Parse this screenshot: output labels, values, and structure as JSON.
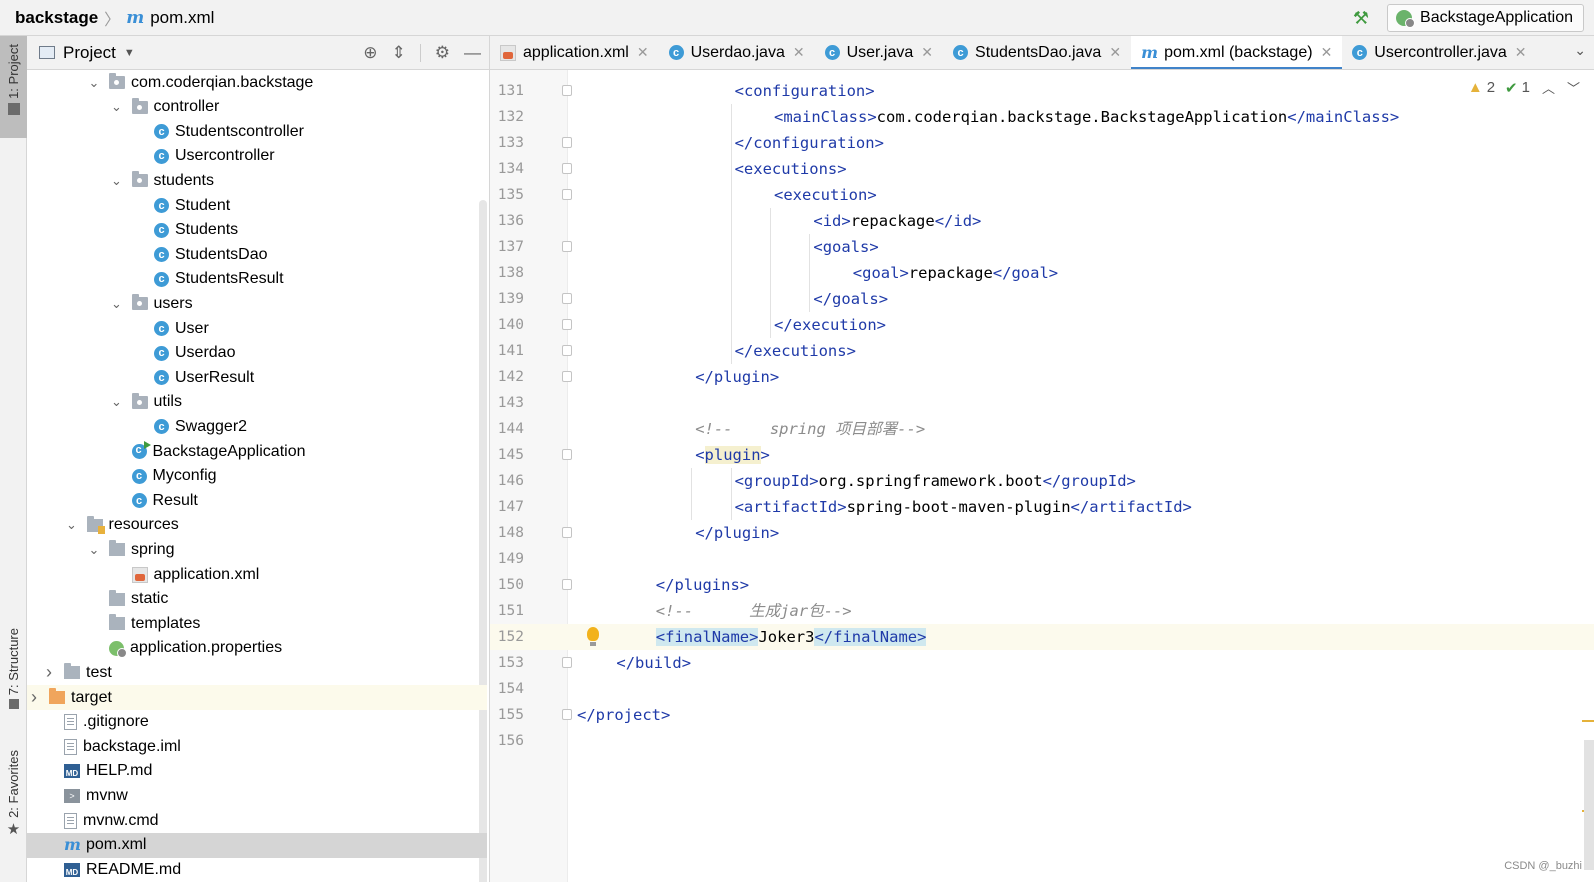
{
  "breadcrumb": {
    "root": "backstage",
    "file": "pom.xml"
  },
  "run_config": {
    "label": "BackstageApplication"
  },
  "left_strip": {
    "project_tab": "1: Project",
    "structure_tab": "7: Structure",
    "favorites_tab": "2: Favorites"
  },
  "project_panel": {
    "title": "Project"
  },
  "tree": [
    {
      "label": "com.coderqian.backstage",
      "icon": "pkg",
      "depth": 4,
      "arrow": "open"
    },
    {
      "label": "controller",
      "icon": "pkg",
      "depth": 5,
      "arrow": "open"
    },
    {
      "label": "Studentscontroller",
      "icon": "cls",
      "depth": 6,
      "arrow": "none"
    },
    {
      "label": "Usercontroller",
      "icon": "cls",
      "depth": 6,
      "arrow": "none"
    },
    {
      "label": "students",
      "icon": "pkg",
      "depth": 5,
      "arrow": "open"
    },
    {
      "label": "Student",
      "icon": "cls",
      "depth": 6,
      "arrow": "none"
    },
    {
      "label": "Students",
      "icon": "cls",
      "depth": 6,
      "arrow": "none"
    },
    {
      "label": "StudentsDao",
      "icon": "cls",
      "depth": 6,
      "arrow": "none"
    },
    {
      "label": "StudentsResult",
      "icon": "cls",
      "depth": 6,
      "arrow": "none"
    },
    {
      "label": "users",
      "icon": "pkg",
      "depth": 5,
      "arrow": "open"
    },
    {
      "label": "User",
      "icon": "cls",
      "depth": 6,
      "arrow": "none"
    },
    {
      "label": "Userdao",
      "icon": "cls",
      "depth": 6,
      "arrow": "none"
    },
    {
      "label": "UserResult",
      "icon": "cls",
      "depth": 6,
      "arrow": "none"
    },
    {
      "label": "utils",
      "icon": "pkg",
      "depth": 5,
      "arrow": "open"
    },
    {
      "label": "Swagger2",
      "icon": "cls",
      "depth": 6,
      "arrow": "none"
    },
    {
      "label": "BackstageApplication",
      "icon": "app",
      "depth": 5,
      "arrow": "none"
    },
    {
      "label": "Myconfig",
      "icon": "cls",
      "depth": 5,
      "arrow": "none"
    },
    {
      "label": "Result",
      "icon": "cls",
      "depth": 5,
      "arrow": "none"
    },
    {
      "label": "resources",
      "icon": "res",
      "depth": 3,
      "arrow": "open"
    },
    {
      "label": "spring",
      "icon": "folder",
      "depth": 4,
      "arrow": "open"
    },
    {
      "label": "application.xml",
      "icon": "xml",
      "depth": 5,
      "arrow": "none"
    },
    {
      "label": "static",
      "icon": "folder",
      "depth": 4,
      "arrow": "none"
    },
    {
      "label": "templates",
      "icon": "folder",
      "depth": 4,
      "arrow": "none"
    },
    {
      "label": "application.properties",
      "icon": "props",
      "depth": 4,
      "arrow": "none"
    },
    {
      "label": "test",
      "icon": "folder",
      "depth": 2,
      "arrow": "closed"
    },
    {
      "label": "target",
      "icon": "folder-orange",
      "depth": 1,
      "arrow": "closed",
      "state": "highlight"
    },
    {
      "label": ".gitignore",
      "icon": "file",
      "depth": 2,
      "arrow": "none"
    },
    {
      "label": "backstage.iml",
      "icon": "file",
      "depth": 2,
      "arrow": "none"
    },
    {
      "label": "HELP.md",
      "icon": "md",
      "depth": 2,
      "arrow": "none"
    },
    {
      "label": "mvnw",
      "icon": "sh",
      "depth": 2,
      "arrow": "none"
    },
    {
      "label": "mvnw.cmd",
      "icon": "file",
      "depth": 2,
      "arrow": "none"
    },
    {
      "label": "pom.xml",
      "icon": "m",
      "depth": 2,
      "arrow": "none",
      "state": "selected"
    },
    {
      "label": "README.md",
      "icon": "md",
      "depth": 2,
      "arrow": "none"
    }
  ],
  "tabs": [
    {
      "label": "application.xml",
      "icon": "xml",
      "active": false
    },
    {
      "label": "Userdao.java",
      "icon": "cls",
      "active": false
    },
    {
      "label": "User.java",
      "icon": "cls",
      "active": false
    },
    {
      "label": "StudentsDao.java",
      "icon": "cls",
      "active": false
    },
    {
      "label": "pom.xml (backstage)",
      "icon": "m",
      "active": true
    },
    {
      "label": "Usercontroller.java",
      "icon": "cls",
      "active": false
    }
  ],
  "inspection": {
    "warnings": "2",
    "ok": "1"
  },
  "code_lines": [
    {
      "n": "131",
      "indent": 4,
      "parts": [
        [
          "tag",
          "<"
        ],
        [
          "tag",
          "configuration"
        ],
        [
          "tag",
          ">"
        ]
      ]
    },
    {
      "n": "132",
      "indent": 5,
      "parts": [
        [
          "tag",
          "<mainClass>"
        ],
        [
          "txt",
          "com.coderqian.backstage.BackstageApplication"
        ],
        [
          "tag",
          "</mainClass>"
        ]
      ]
    },
    {
      "n": "133",
      "indent": 4,
      "parts": [
        [
          "tag",
          "</configuration>"
        ]
      ]
    },
    {
      "n": "134",
      "indent": 4,
      "parts": [
        [
          "tag",
          "<executions>"
        ]
      ]
    },
    {
      "n": "135",
      "indent": 5,
      "parts": [
        [
          "tag",
          "<execution>"
        ]
      ]
    },
    {
      "n": "136",
      "indent": 6,
      "parts": [
        [
          "tag",
          "<id>"
        ],
        [
          "txt",
          "repackage"
        ],
        [
          "tag",
          "</id>"
        ]
      ]
    },
    {
      "n": "137",
      "indent": 6,
      "parts": [
        [
          "tag",
          "<goals>"
        ]
      ]
    },
    {
      "n": "138",
      "indent": 7,
      "parts": [
        [
          "tag",
          "<goal>"
        ],
        [
          "txt",
          "repackage"
        ],
        [
          "tag",
          "</goal>"
        ]
      ]
    },
    {
      "n": "139",
      "indent": 6,
      "parts": [
        [
          "tag",
          "</goals>"
        ]
      ]
    },
    {
      "n": "140",
      "indent": 5,
      "parts": [
        [
          "tag",
          "</execution>"
        ]
      ]
    },
    {
      "n": "141",
      "indent": 4,
      "parts": [
        [
          "tag",
          "</executions>"
        ]
      ]
    },
    {
      "n": "142",
      "indent": 3,
      "parts": [
        [
          "tag",
          "</plugin>"
        ]
      ]
    },
    {
      "n": "143",
      "indent": 0,
      "parts": []
    },
    {
      "n": "144",
      "indent": 3,
      "parts": [
        [
          "cmt",
          "<!--    spring 项目部署-->"
        ]
      ]
    },
    {
      "n": "145",
      "indent": 3,
      "parts": [
        [
          "tag",
          "<"
        ],
        [
          "plug",
          "plugin"
        ],
        [
          "tag",
          ">"
        ]
      ]
    },
    {
      "n": "146",
      "indent": 4,
      "parts": [
        [
          "tag",
          "<groupId>"
        ],
        [
          "txt",
          "org.springframework.boot"
        ],
        [
          "tag",
          "</groupId>"
        ]
      ]
    },
    {
      "n": "147",
      "indent": 4,
      "parts": [
        [
          "tag",
          "<artifactId>"
        ],
        [
          "txt",
          "spring-boot-maven-plugin"
        ],
        [
          "tag",
          "</artifactId>"
        ]
      ]
    },
    {
      "n": "148",
      "indent": 3,
      "parts": [
        [
          "tag",
          "</plugin>"
        ]
      ]
    },
    {
      "n": "149",
      "indent": 0,
      "parts": []
    },
    {
      "n": "150",
      "indent": 2,
      "parts": [
        [
          "tag",
          "</plugins>"
        ]
      ]
    },
    {
      "n": "151",
      "indent": 2,
      "parts": [
        [
          "cmt",
          "<!--      生成jar包-->"
        ]
      ]
    },
    {
      "n": "152",
      "indent": 2,
      "parts": [
        [
          "tagbg",
          "<finalName>"
        ],
        [
          "txt",
          "Joker3"
        ],
        [
          "tagbg",
          "</finalName>"
        ]
      ],
      "current": true
    },
    {
      "n": "153",
      "indent": 1,
      "parts": [
        [
          "tag",
          "</build>"
        ]
      ]
    },
    {
      "n": "154",
      "indent": 0,
      "parts": []
    },
    {
      "n": "155",
      "indent": 0,
      "parts": [
        [
          "tag",
          "</project>"
        ]
      ]
    },
    {
      "n": "156",
      "indent": 0,
      "parts": []
    }
  ],
  "watermark": "CSDN @_buzhi"
}
